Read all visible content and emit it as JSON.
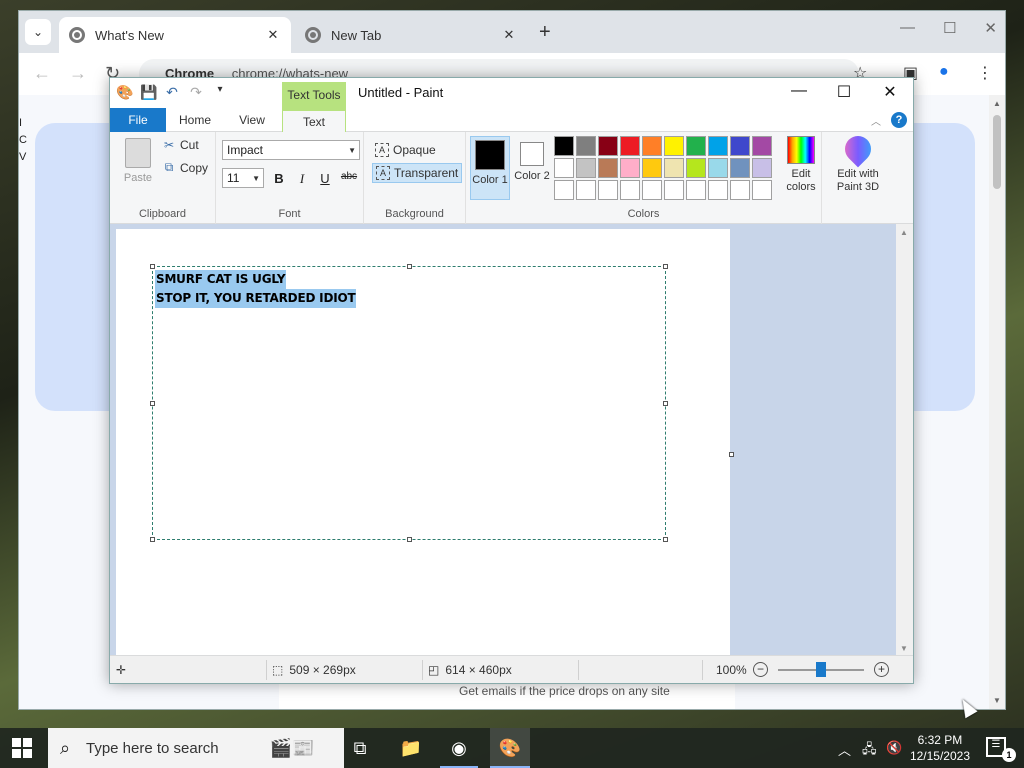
{
  "chrome": {
    "tabs": [
      {
        "label": "What's New",
        "active": true
      },
      {
        "label": "New Tab",
        "active": false
      }
    ],
    "new_tab": "+",
    "omnibox_chip": "Chrome",
    "url": "chrome://whats-new",
    "page": {
      "left_stub": [
        "I",
        "C",
        "V"
      ],
      "product_text": "Get emails if the price drops on any site"
    }
  },
  "paint": {
    "title": "Untitled - Paint",
    "context_tab": "Text Tools",
    "ribbon_tabs": {
      "file": "File",
      "home": "Home",
      "view": "View",
      "text": "Text"
    },
    "clipboard": {
      "label": "Clipboard",
      "paste": "Paste",
      "cut": "Cut",
      "copy": "Copy"
    },
    "font": {
      "label": "Font",
      "family": "Impact",
      "size": "11",
      "bold": "B",
      "italic": "I",
      "underline": "U",
      "strike": "abc"
    },
    "background": {
      "label": "Background",
      "opaque": "Opaque",
      "transparent": "Transparent"
    },
    "colors": {
      "label": "Colors",
      "color1": "Color 1",
      "color2": "Color 2",
      "color1_value": "#000000",
      "color2_value": "#ffffff",
      "edit_colors": "Edit colors",
      "paint3d": "Edit with Paint 3D",
      "palette_row1": [
        "#000000",
        "#7f7f7f",
        "#880015",
        "#ed1c24",
        "#ff7f27",
        "#fff200",
        "#22b14c",
        "#00a2e8",
        "#3f48cc",
        "#a349a4"
      ],
      "palette_row2": [
        "#ffffff",
        "#c3c3c3",
        "#b97a57",
        "#ffaec9",
        "#ffc90e",
        "#efe4b0",
        "#b5e61d",
        "#99d9ea",
        "#7092be",
        "#c8bfe7"
      ],
      "palette_row3": [
        "#ffffff",
        "#ffffff",
        "#ffffff",
        "#ffffff",
        "#ffffff",
        "#ffffff",
        "#ffffff",
        "#ffffff",
        "#ffffff",
        "#ffffff"
      ]
    },
    "canvas_text": [
      "SMURF CAT IS UGLY",
      "STOP IT, YOU RETARDED IDIOT"
    ],
    "status": {
      "selection": "509 × 269px",
      "canvas_size": "614 × 460px",
      "zoom": "100%",
      "zoom_level": 100
    }
  },
  "taskbar": {
    "search_placeholder": "Type here to search",
    "time": "6:32 PM",
    "date": "12/15/2023",
    "notif_count": "1"
  }
}
